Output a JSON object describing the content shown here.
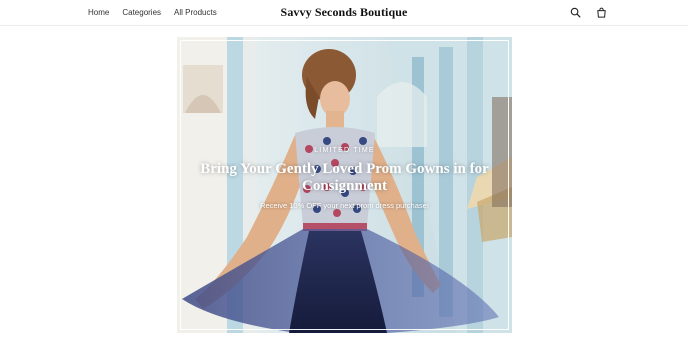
{
  "header": {
    "brand": "Savvy Seconds Boutique",
    "nav": [
      "Home",
      "Categories",
      "All Products"
    ],
    "icons": [
      "search-icon",
      "cart-icon"
    ]
  },
  "hero": {
    "eyebrow": "LIMITED TIME",
    "headline": "Bring Your Gently Loved Prom Gowns in for Consignment",
    "subtext": "Receive 10% OFF your next prom dress purchase!",
    "image": "woman-in-embellished-prom-gown-photo"
  },
  "colors": {
    "text": "#222222",
    "brand": "#111111",
    "overlay_text": "#ffffff",
    "dress_navy": "#232a4d"
  }
}
